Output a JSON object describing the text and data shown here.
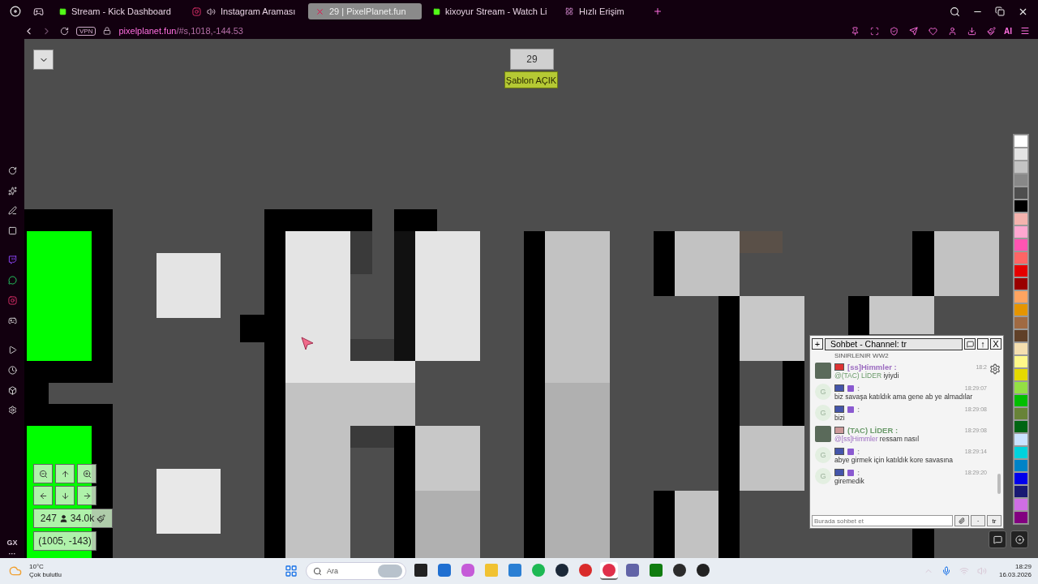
{
  "browser": {
    "tabs": [
      {
        "title": "Stream - Kick Dashboard",
        "kind": "kick",
        "selected": false
      },
      {
        "title": "Instagram Araması",
        "kind": "instagram",
        "selected": false
      },
      {
        "title": "29 | PixelPlanet.fun",
        "kind": "pixel",
        "selected": true
      },
      {
        "title": "kixoyur Stream - Watch Li",
        "kind": "kick",
        "selected": false
      },
      {
        "title": "Hızlı Erişim",
        "kind": "grid",
        "selected": false
      }
    ],
    "address": {
      "host": "pixelplanet.fun",
      "path": "/#s,1018,-144.53"
    },
    "vpn": "VPN",
    "ai": "AI"
  },
  "sidebar": {
    "gx": "GX",
    "more": "···"
  },
  "canvas": {
    "online_count": "29",
    "template_toggle": "Şablon AÇIK",
    "users": "247",
    "pixels": "34.0k",
    "coordinates": "(1005, -143)",
    "palette": [
      {
        "color": "#ffffff"
      },
      {
        "color": "#e4e4e4"
      },
      {
        "color": "#c4c4c4"
      },
      {
        "color": "#888888"
      },
      {
        "color": "#4e4e4e"
      },
      {
        "color": "#000000"
      },
      {
        "color": "#f4b3ae"
      },
      {
        "color": "#ffa7d1"
      },
      {
        "color": "#ff54b2"
      },
      {
        "color": "#ff6565"
      },
      {
        "color": "#e50000"
      },
      {
        "color": "#9a0000"
      },
      {
        "color": "#fea460"
      },
      {
        "color": "#e59500"
      },
      {
        "color": "#a06a42"
      },
      {
        "color": "#604028"
      },
      {
        "color": "#f5dfb0"
      },
      {
        "color": "#fff889"
      },
      {
        "color": "#e5d900"
      },
      {
        "color": "#94e044"
      },
      {
        "color": "#02be01"
      },
      {
        "color": "#688338"
      },
      {
        "color": "#006513"
      },
      {
        "color": "#cae3ff"
      },
      {
        "color": "#00d3dd"
      },
      {
        "color": "#0083c7"
      },
      {
        "color": "#0000ea"
      },
      {
        "color": "#191973"
      },
      {
        "color": "#cf6ee4"
      },
      {
        "color": "#820080"
      }
    ]
  },
  "chat": {
    "plus": "+",
    "title": "Sohbet - Channel: tr",
    "up": "↑",
    "close": "X",
    "cut_line": "SINIRLENIR WW2",
    "messages": [
      {
        "kind": "photo",
        "name": "[ss]Himmler :",
        "color": "#9b6bc0",
        "time": "18:2",
        "mention": "@(TAC) LİDER",
        "text": " iyiydi"
      },
      {
        "kind": "letter",
        "letter": "G",
        "name": ":",
        "time": "18:29:07",
        "text": "biz savaşa katıldık ama gene ab ye almadılar"
      },
      {
        "kind": "letter",
        "letter": "G",
        "name": ":",
        "time": "18:29:08",
        "text": "bizi"
      },
      {
        "kind": "photo",
        "name": "(TAC) LİDER :",
        "color": "#6a9a6a",
        "time": "18:29:08",
        "mention": "@[ss]Himmler",
        "text": " ressam nasıl"
      },
      {
        "kind": "letter",
        "letter": "G",
        "name": ":",
        "time": "18:29:14",
        "text": "abye girmek için katıldık kore savasına"
      },
      {
        "kind": "letter",
        "letter": "G",
        "name": ":",
        "time": "18:29:20",
        "text": "giremedik"
      }
    ],
    "placeholder": "Burada sohbet et",
    "dot": "·",
    "channel": "tr"
  },
  "taskbar": {
    "temperature": "10°C",
    "weather": "Çok bulutlu",
    "search_placeholder": "Ara",
    "apps": [
      {
        "kind": "taskview",
        "selected": false
      },
      {
        "kind": "mail",
        "selected": false
      },
      {
        "kind": "copilot",
        "selected": false
      },
      {
        "kind": "folder",
        "selected": false
      },
      {
        "kind": "store",
        "selected": false
      },
      {
        "kind": "spotify",
        "selected": false
      },
      {
        "kind": "steam",
        "selected": false
      },
      {
        "kind": "red",
        "selected": false
      },
      {
        "kind": "opera",
        "selected": true
      },
      {
        "kind": "teams",
        "selected": false
      },
      {
        "kind": "xbox",
        "selected": false
      },
      {
        "kind": "obs",
        "selected": false
      },
      {
        "kind": "g",
        "selected": false
      }
    ],
    "time": "18:29",
    "date": "16.03.2026"
  }
}
